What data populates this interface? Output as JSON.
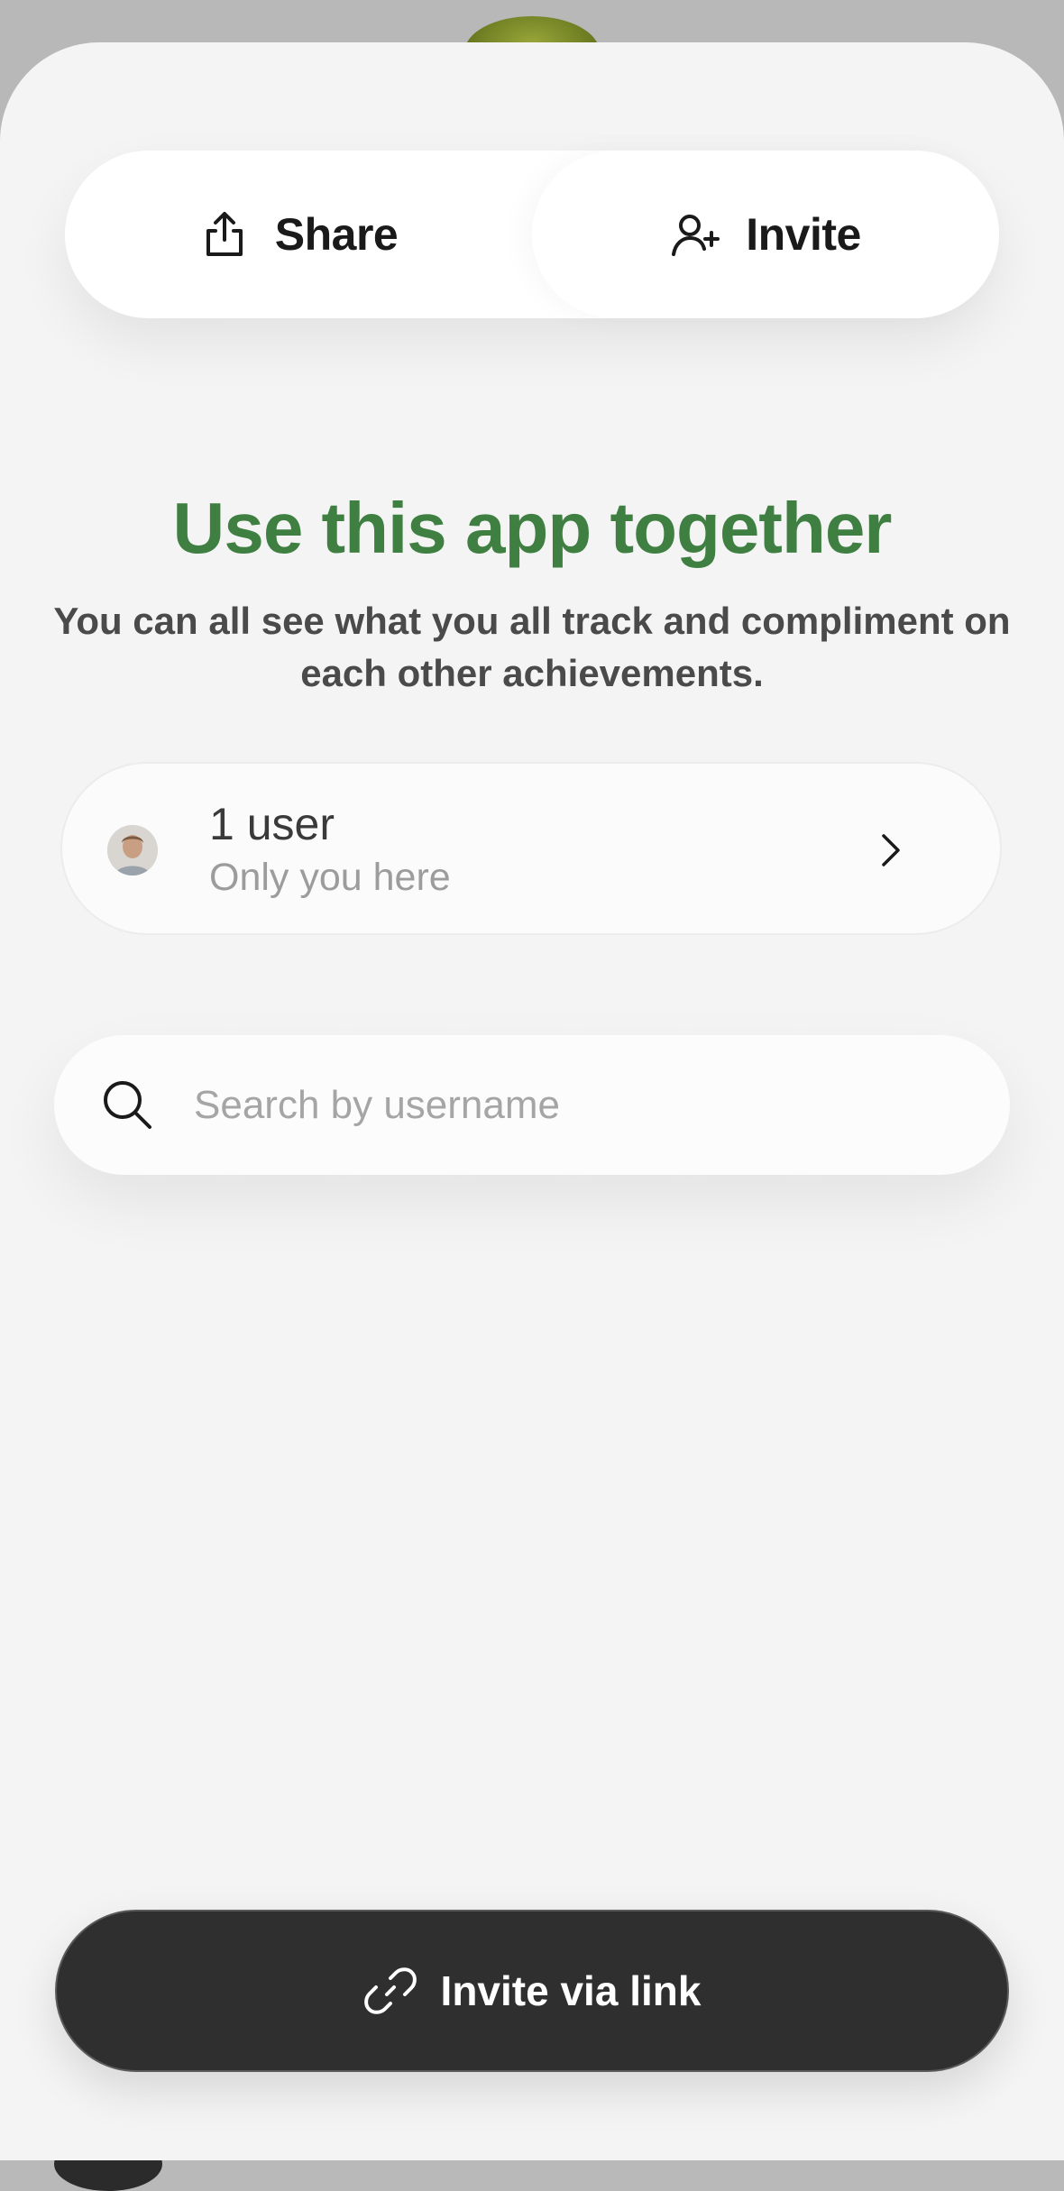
{
  "tabs": [
    {
      "label": "Share",
      "icon": "share-icon"
    },
    {
      "label": "Invite",
      "icon": "add-user-icon"
    }
  ],
  "active_tab": "Invite",
  "title": "Use this app together",
  "subtitle": "You can all see what you all track and compliment on each other achievements.",
  "users": {
    "count_label": "1 user",
    "status": "Only you here"
  },
  "search": {
    "placeholder": "Search by username"
  },
  "cta": {
    "label": "Invite via link",
    "icon": "link-icon"
  },
  "colors": {
    "title_green": "#3f7f42",
    "cta_background": "#2f2f2f",
    "sheet_background": "#f4f4f4"
  }
}
